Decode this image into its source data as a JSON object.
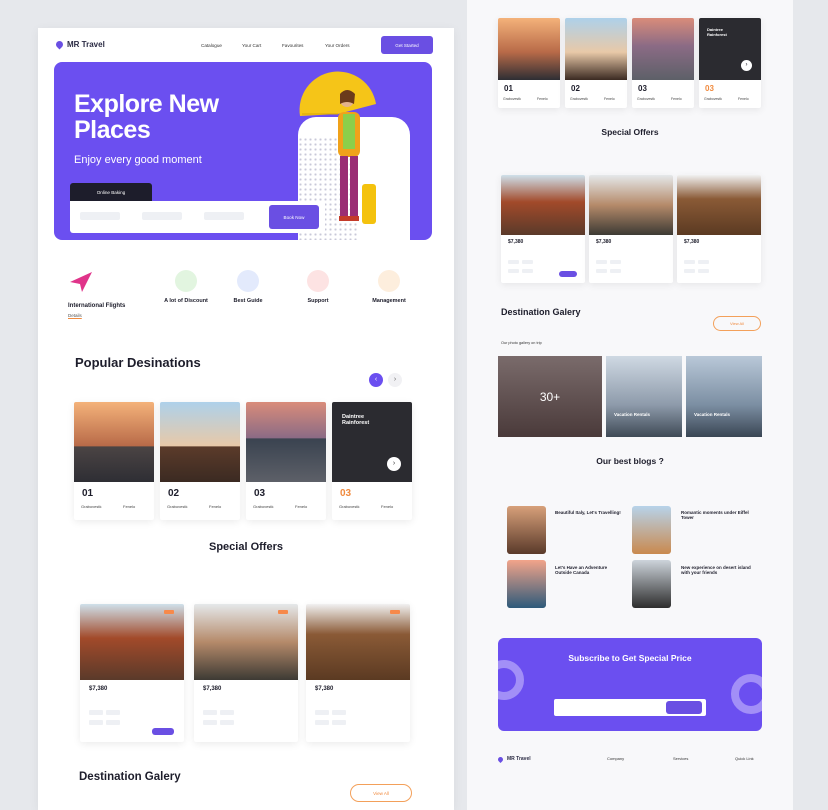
{
  "left_page": {
    "logo": "MR Travel",
    "nav": [
      "Catalogue",
      "Your Cart",
      "Favourites",
      "Your Orders"
    ],
    "cta": "Get Started",
    "hero": {
      "title_line1": "Explore New",
      "title_line2": "Places",
      "subtitle": "Enjoy every good moment",
      "tab": "Online Baking",
      "book_label": "Book Now"
    },
    "features": [
      {
        "title": "International Flights",
        "link": "Details"
      },
      {
        "title": "A lot of Discount"
      },
      {
        "title": "Best Guide"
      },
      {
        "title": "Support"
      },
      {
        "title": "Management"
      }
    ],
    "popular": {
      "title": "Popular Desinations",
      "cards": [
        {
          "num": "01",
          "a": "Grabovestk",
          "b": "Fenelo"
        },
        {
          "num": "02",
          "a": "Grabovestk",
          "b": "Fenelo"
        },
        {
          "num": "03",
          "a": "Grabovestk",
          "b": "Fenelo"
        },
        {
          "num": "03",
          "a": "Grabovestk",
          "b": "Fenelo",
          "overlay_title": "Daintree Rainforest"
        }
      ]
    },
    "offers": {
      "title": "Special Offers",
      "prices": [
        "$7,380",
        "$7,380",
        "$7,380"
      ]
    },
    "gallery": {
      "title": "Destination Galery",
      "button": "View All"
    }
  },
  "right_page": {
    "top_cards": [
      {
        "num": "01",
        "a": "Grabovestk",
        "b": "Fenelo"
      },
      {
        "num": "02",
        "a": "Grabovestk",
        "b": "Fenelo"
      },
      {
        "num": "03",
        "a": "Grabovestk",
        "b": "Fenelo"
      },
      {
        "num": "03",
        "a": "Grabovestk",
        "b": "Fenelo",
        "overlay_title": "Daintree Rainforest"
      }
    ],
    "offers": {
      "title": "Special Offers",
      "prices": [
        "$7,380",
        "$7,380",
        "$7,380"
      ]
    },
    "gallery": {
      "title": "Destination Galery",
      "button": "View All",
      "caption": "Our photo gallery on trip",
      "count": "30+",
      "img2": "Vacation Rentals",
      "img3": "Vacation Rentals"
    },
    "blogs": {
      "title": "Our best blogs ?",
      "items": [
        "Beautiful Italy, Let's Travelling!",
        "Romantic moments under Eiffel Tower",
        "Let's Have an Adventure Outside Canada",
        "New experience on desert island with your friends"
      ]
    },
    "subscribe": {
      "title": "Subscribe to Get Special Price"
    },
    "footer": {
      "logo": "MR Travel",
      "cols": [
        "Company",
        "Services",
        "Quick Link"
      ]
    }
  },
  "colors": {
    "primary": "#6b4ff0",
    "accent": "#f08a3e"
  }
}
